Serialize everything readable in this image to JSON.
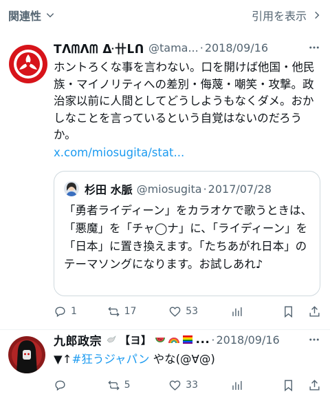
{
  "topbar": {
    "sort_label": "関連性",
    "view_quotes_label": "引用を表示"
  },
  "post1": {
    "name": "Tᐱᗰᐱᗰ ᐏ卄ᒪᑎ",
    "handle": "@tama...",
    "dot": "·",
    "date": "2018/09/16",
    "text": "ホントろくな事を言わない。口を開けば他国・他民族・マイノリティへの差別・侮蔑・嘲笑・攻撃。政治家以前に人間としてどうしようもなくダメ。おかしなことを言っているという自覚はないのだろうか。",
    "link": "x.com/miosugita/stat...",
    "quote": {
      "name": "杉田 水脈",
      "handle": "@miosugita",
      "dot": "·",
      "date": "2017/07/28",
      "text": "「勇者ライディーン」をカラオケで歌うときは、「悪魔」を「チャ◯ナ」に、「ライディーン」を「日本」に置き換えます。「たちあがれ日本」のテーマソングになります。お試しあれ♪"
    },
    "stats": {
      "replies": "1",
      "reposts": "17",
      "likes": "53"
    }
  },
  "post2": {
    "name": "九郎政宗",
    "name_suffix": "【ヨ】",
    "ellipsis": "...",
    "dot": "·",
    "date": "2018/09/16",
    "text_prefix": "▼↑",
    "hashtag": "#狂うジャパン",
    "text_suffix": " やな(@∀@)",
    "stats": {
      "replies": "",
      "reposts": "5",
      "likes": "33"
    }
  },
  "colors": {
    "accent": "#1d9bf0",
    "secondary": "#536471",
    "border": "#cfd9de",
    "logo_red": "#d7141a"
  },
  "icons": [
    "chevron-down-icon",
    "chevron-right-icon",
    "more-icon",
    "reply-icon",
    "repost-icon",
    "like-icon",
    "views-icon",
    "bookmark-icon",
    "share-icon"
  ]
}
